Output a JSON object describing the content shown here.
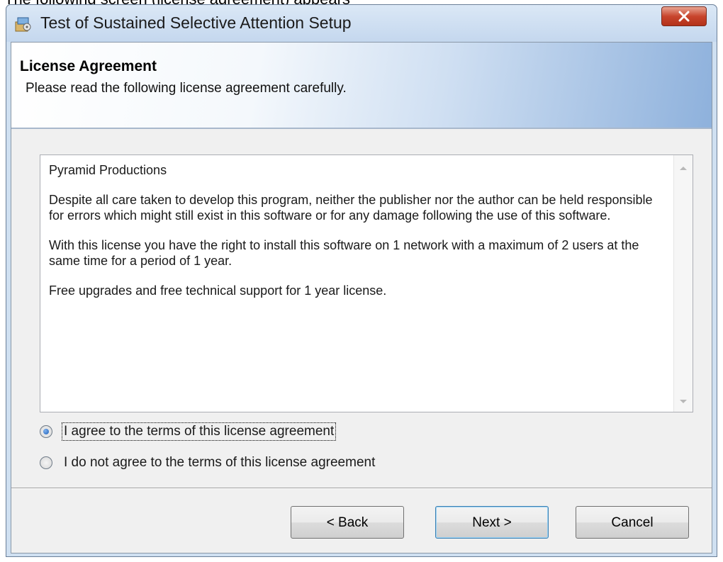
{
  "document": {
    "caption_fragment": "The following screen (license agreement) appears"
  },
  "window": {
    "title": "Test of Sustained Selective Attention Setup",
    "icon": "setup-package-icon",
    "close_icon": "close-x-icon"
  },
  "banner": {
    "title": "License Agreement",
    "subtitle": "Please read the following license agreement carefully."
  },
  "license": {
    "paragraphs": [
      "Pyramid Productions",
      "Despite all care taken to develop this program, neither the publisher nor the author can be held responsible for errors which might still exist in this software or for any damage following the use of this software.",
      "With this license you have the right to install this software on 1 network with a maximum of 2 users at the same time for a period of 1 year.",
      "Free upgrades and free technical support for 1 year license."
    ]
  },
  "options": {
    "agree_label": "I agree to the terms of this license agreement",
    "disagree_label": "I do not agree to the terms of this license agreement",
    "selected": "agree"
  },
  "buttons": {
    "back_label": "< Back",
    "next_label": "Next >",
    "cancel_label": "Cancel"
  },
  "colors": {
    "banner_accent": "#8eb1dc",
    "radio_selected": "#1d5fb8",
    "close_button": "#c8452d"
  }
}
